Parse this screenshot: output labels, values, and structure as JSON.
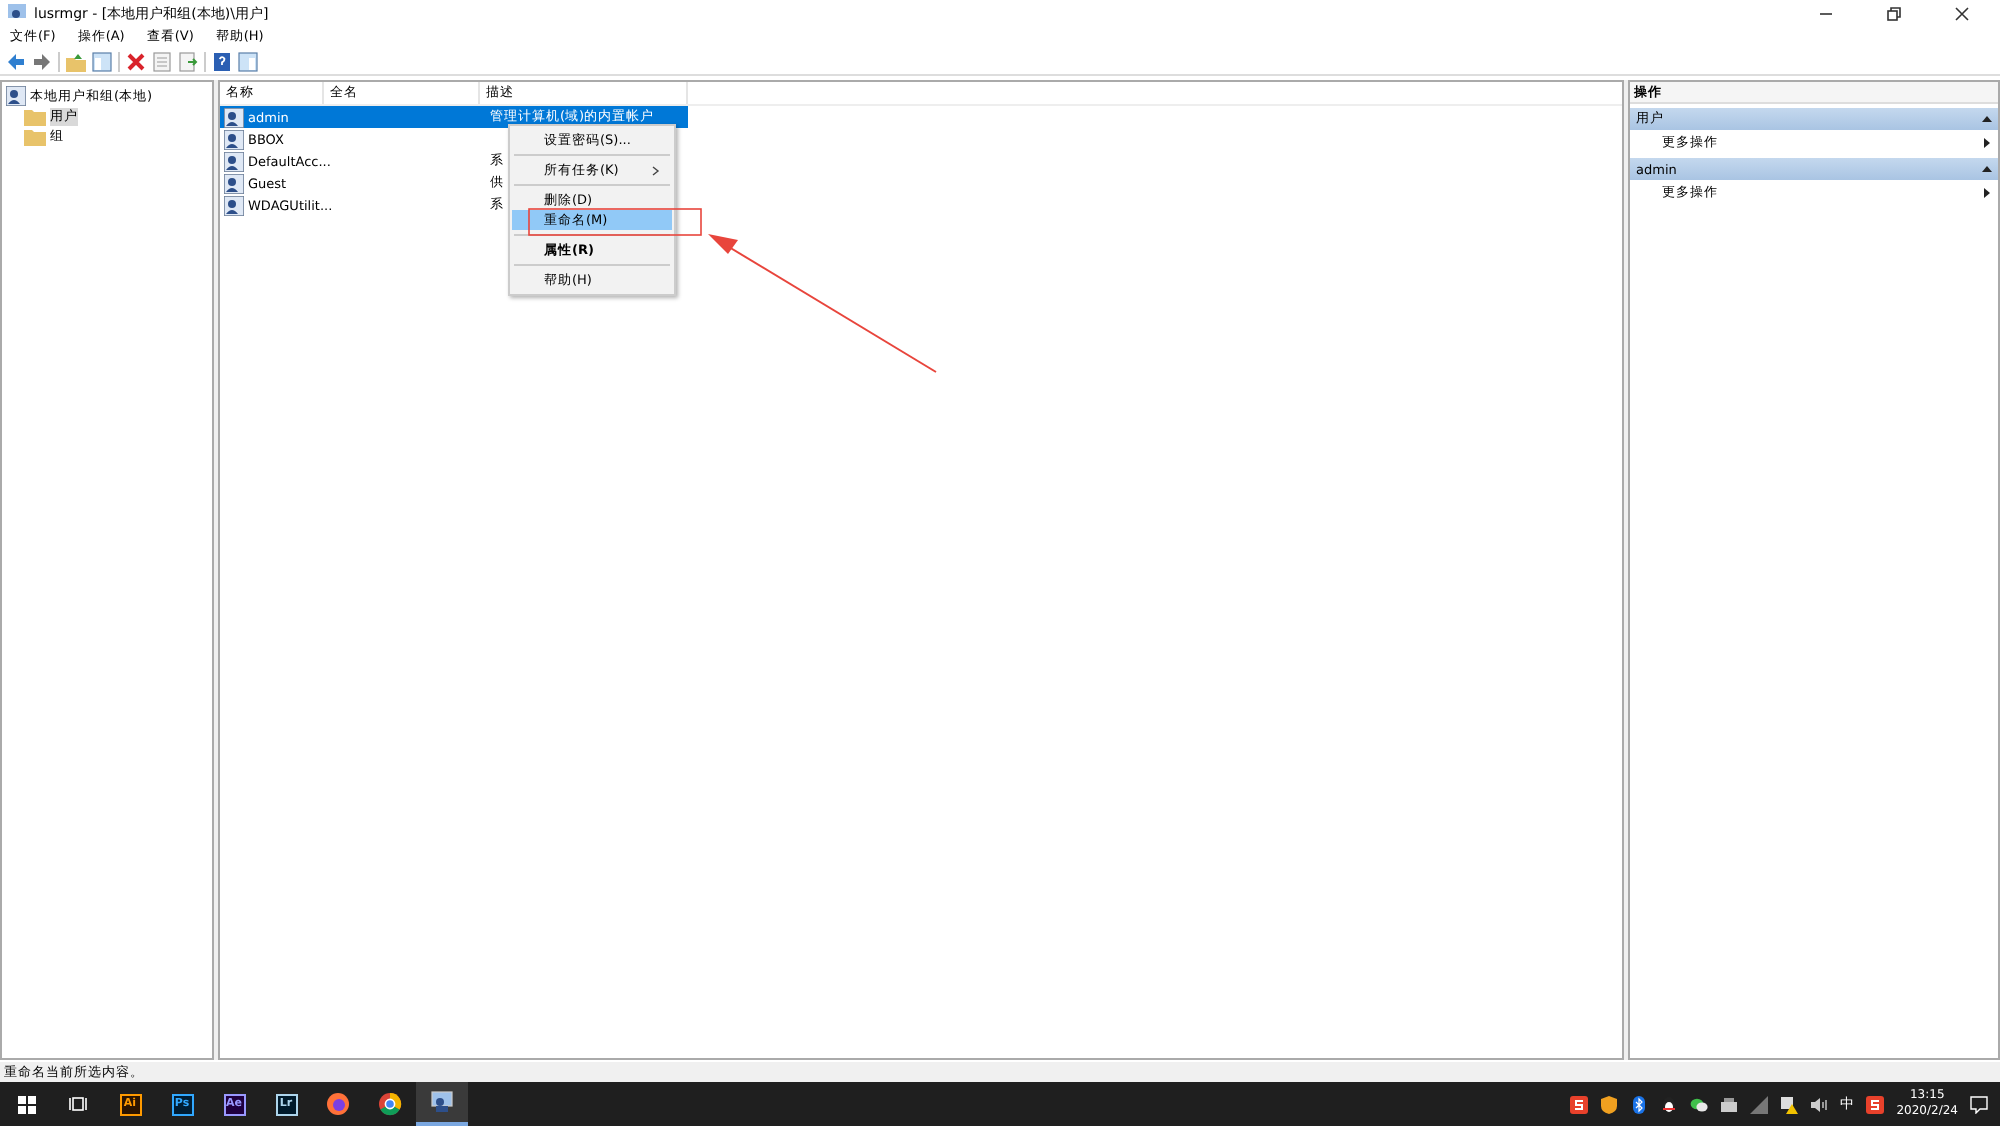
{
  "window": {
    "title": "lusrmgr - [本地用户和组(本地)\\用户]"
  },
  "menu": [
    "文件(F)",
    "操作(A)",
    "查看(V)",
    "帮助(H)"
  ],
  "tree": {
    "label": "本地用户和组(本地)",
    "children": [
      {
        "label": "用户",
        "selected": true
      },
      {
        "label": "组",
        "selected": false
      }
    ]
  },
  "table": {
    "columns": [
      "名称",
      "全名",
      "描述"
    ],
    "rows": [
      {
        "name": "admin",
        "description": "管理计算机(域)的内置帐户",
        "selected": true
      },
      {
        "name": "BBOX",
        "selected": false
      },
      {
        "name": "DefaultAcc...",
        "description": "系",
        "selected": false
      },
      {
        "name": "Guest",
        "description": "供",
        "selected": false
      },
      {
        "name": "WDAGUtilit...",
        "description": "系",
        "selected": false
      }
    ]
  },
  "context_menu": {
    "items": [
      {
        "label": "设置密码(S)...",
        "kind": "item",
        "bold": false,
        "submenu": false,
        "selected": false
      },
      {
        "kind": "separator"
      },
      {
        "label": "所有任务(K)",
        "kind": "item",
        "bold": false,
        "submenu": true,
        "selected": false
      },
      {
        "kind": "separator"
      },
      {
        "label": "删除(D)",
        "kind": "item",
        "bold": false,
        "submenu": false,
        "selected": false
      },
      {
        "label": "重命名(M)",
        "kind": "item",
        "bold": false,
        "submenu": false,
        "selected": true
      },
      {
        "kind": "separator"
      },
      {
        "label": "属性(R)",
        "kind": "item",
        "bold": true,
        "submenu": false,
        "selected": false
      },
      {
        "kind": "separator"
      },
      {
        "label": "帮助(H)",
        "kind": "item",
        "bold": false,
        "submenu": false,
        "selected": false
      }
    ]
  },
  "actions": {
    "title": "操作",
    "sections": [
      {
        "title": "用户",
        "items": [
          "更多操作"
        ]
      },
      {
        "title": "admin",
        "items": [
          "更多操作"
        ]
      }
    ]
  },
  "status_bar": "重命名当前所选内容。",
  "taskbar": {
    "apps": [
      {
        "kind": "ai",
        "label": "Ai"
      },
      {
        "kind": "ps",
        "label": "Ps"
      },
      {
        "kind": "ae",
        "label": "Ae"
      },
      {
        "kind": "lr",
        "label": "Lr"
      },
      {
        "kind": "firefox"
      },
      {
        "kind": "chrome"
      },
      {
        "kind": "mmc"
      }
    ],
    "ime": "中",
    "time": "13:15",
    "date": "2020/2/24"
  }
}
